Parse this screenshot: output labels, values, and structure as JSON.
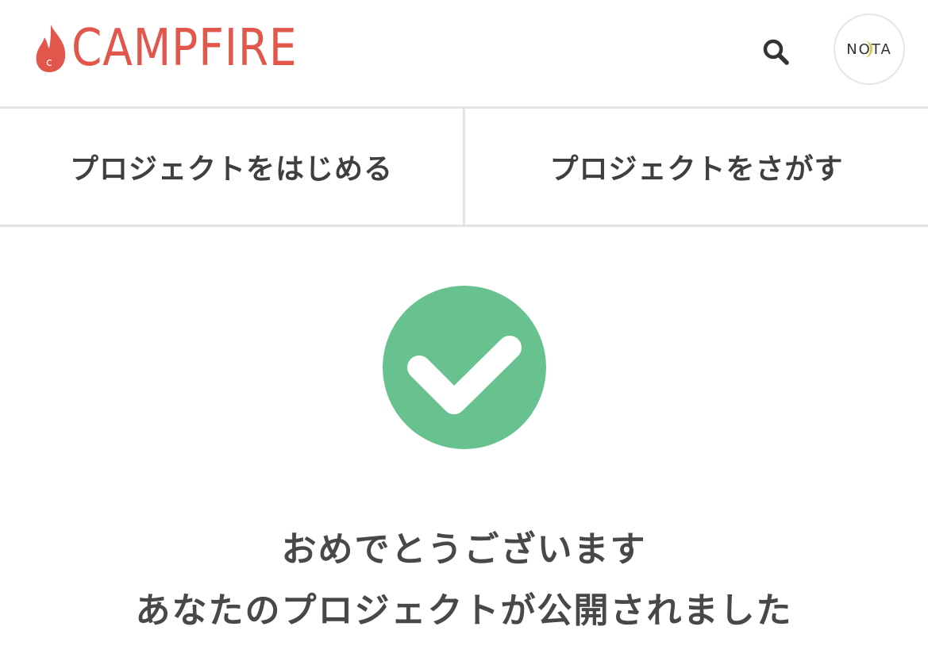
{
  "header": {
    "logo_text": "CAMPFIRE",
    "logo_color": "#e2574c",
    "search_icon": "search-icon",
    "avatar_label": "NOTA"
  },
  "tabs": [
    {
      "label": "プロジェクトをはじめる"
    },
    {
      "label": "プロジェクトをさがす"
    }
  ],
  "main": {
    "success_icon": "check-circle-icon",
    "success_color": "#67c28f",
    "message_line1": "おめでとうございます",
    "message_line2": "あなたのプロジェクトが公開されました"
  }
}
